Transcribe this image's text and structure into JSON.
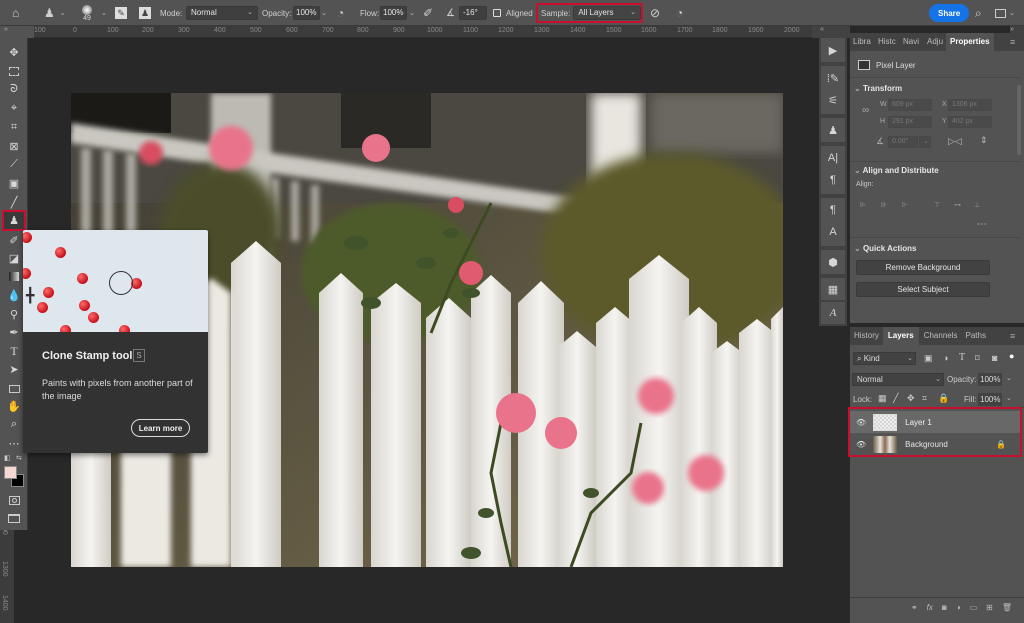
{
  "options_bar": {
    "home_icon": "home-icon",
    "tool_preset_icon": "clone-stamp-icon",
    "brush_size": "49",
    "mode_label": "Mode:",
    "mode_value": "Normal",
    "opacity_label": "Opacity:",
    "opacity_value": "100%",
    "flow_label": "Flow:",
    "flow_value": "100%",
    "angle_value": "-16°",
    "aligned_label": "Aligned",
    "aligned_checked": true,
    "sample_label": "Sample:",
    "sample_value": "All Layers",
    "share_label": "Share",
    "highlight_color": "#c8102e"
  },
  "ruler": {
    "horizontal_ticks": [
      "100",
      "0",
      "100",
      "200",
      "300",
      "400",
      "500",
      "600",
      "700",
      "800",
      "900",
      "1000",
      "1100",
      "1200",
      "1300",
      "1400",
      "1500",
      "1600",
      "1700",
      "1800",
      "1900",
      "2000"
    ],
    "vertical_ticks": [
      "00",
      "1300",
      "1400"
    ]
  },
  "tooltip": {
    "title": "Clone Stamp tool",
    "shortcut": "S",
    "description": "Paints with pixels from another part of the image",
    "learn_more": "Learn more"
  },
  "properties_panel": {
    "tabs": [
      {
        "label": "Libra",
        "active": false
      },
      {
        "label": "Histc",
        "active": false
      },
      {
        "label": "Navi",
        "active": false
      },
      {
        "label": "Adju",
        "active": false
      },
      {
        "label": "Properties",
        "active": true
      }
    ],
    "layer_type": "Pixel Layer",
    "transform_title": "Transform",
    "w_label": "W",
    "w_value": "609 px",
    "x_label": "X",
    "x_value": "1306 px",
    "h_label": "H",
    "h_value": "291 px",
    "y_label": "Y",
    "y_value": "402 px",
    "angle_value": "0.00°",
    "align_title": "Align and Distribute",
    "align_label": "Align:",
    "quick_actions_title": "Quick Actions",
    "remove_bg_label": "Remove Background",
    "select_subject_label": "Select Subject"
  },
  "layers_panel": {
    "tabs": [
      {
        "label": "History",
        "active": false
      },
      {
        "label": "Layers",
        "active": true
      },
      {
        "label": "Channels",
        "active": false
      },
      {
        "label": "Paths",
        "active": false
      }
    ],
    "filter_label": "Kind",
    "blend_mode": "Normal",
    "opacity_label": "Opacity:",
    "opacity_value": "100%",
    "lock_label": "Lock:",
    "fill_label": "Fill:",
    "fill_value": "100%",
    "layers": [
      {
        "name": "Layer 1",
        "visible": true,
        "selected": true,
        "locked": false
      },
      {
        "name": "Background",
        "visible": true,
        "selected": false,
        "locked": true
      }
    ]
  },
  "colors": {
    "foreground": "#f7d7d4",
    "background": "#000000",
    "accent": "#1473e6"
  }
}
